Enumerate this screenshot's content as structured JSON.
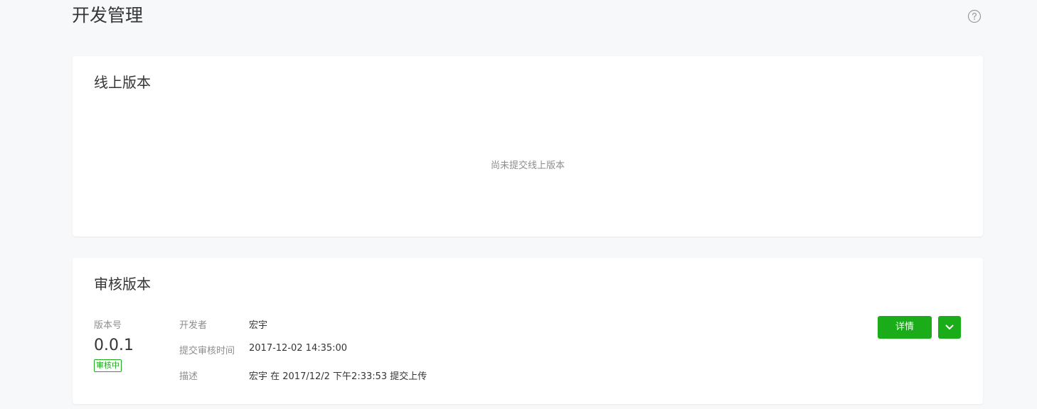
{
  "header": {
    "title": "开发管理",
    "help_icon": "question-circle-icon"
  },
  "online_version": {
    "title": "线上版本",
    "empty_tip": "尚未提交线上版本"
  },
  "review_version": {
    "title": "审核版本",
    "version_label": "版本号",
    "version_number": "0.0.1",
    "status": "审核中",
    "fields": [
      {
        "key": "开发者",
        "value": "宏宇"
      },
      {
        "key": "提交审核时间",
        "value": "2017-12-02 14:35:00"
      },
      {
        "key": "描述",
        "value": "宏宇 在 2017/12/2 下午2:33:53 提交上传"
      }
    ],
    "detail_button": "详情",
    "more_icon": "chevron-down-icon"
  },
  "colors": {
    "accent": "#1aad19",
    "background": "#f6f8f9",
    "card": "#ffffff",
    "muted_text": "#8d8d8d"
  }
}
